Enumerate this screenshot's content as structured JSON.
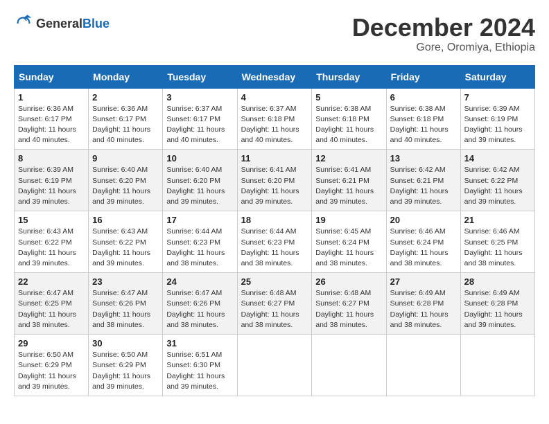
{
  "logo": {
    "general": "General",
    "blue": "Blue"
  },
  "header": {
    "month_year": "December 2024",
    "location": "Gore, Oromiya, Ethiopia"
  },
  "weekdays": [
    "Sunday",
    "Monday",
    "Tuesday",
    "Wednesday",
    "Thursday",
    "Friday",
    "Saturday"
  ],
  "weeks": [
    [
      {
        "day": 1,
        "info": "Sunrise: 6:36 AM\nSunset: 6:17 PM\nDaylight: 11 hours and 40 minutes."
      },
      {
        "day": 2,
        "info": "Sunrise: 6:36 AM\nSunset: 6:17 PM\nDaylight: 11 hours and 40 minutes."
      },
      {
        "day": 3,
        "info": "Sunrise: 6:37 AM\nSunset: 6:17 PM\nDaylight: 11 hours and 40 minutes."
      },
      {
        "day": 4,
        "info": "Sunrise: 6:37 AM\nSunset: 6:18 PM\nDaylight: 11 hours and 40 minutes."
      },
      {
        "day": 5,
        "info": "Sunrise: 6:38 AM\nSunset: 6:18 PM\nDaylight: 11 hours and 40 minutes."
      },
      {
        "day": 6,
        "info": "Sunrise: 6:38 AM\nSunset: 6:18 PM\nDaylight: 11 hours and 40 minutes."
      },
      {
        "day": 7,
        "info": "Sunrise: 6:39 AM\nSunset: 6:19 PM\nDaylight: 11 hours and 39 minutes."
      }
    ],
    [
      {
        "day": 8,
        "info": "Sunrise: 6:39 AM\nSunset: 6:19 PM\nDaylight: 11 hours and 39 minutes."
      },
      {
        "day": 9,
        "info": "Sunrise: 6:40 AM\nSunset: 6:20 PM\nDaylight: 11 hours and 39 minutes."
      },
      {
        "day": 10,
        "info": "Sunrise: 6:40 AM\nSunset: 6:20 PM\nDaylight: 11 hours and 39 minutes."
      },
      {
        "day": 11,
        "info": "Sunrise: 6:41 AM\nSunset: 6:20 PM\nDaylight: 11 hours and 39 minutes."
      },
      {
        "day": 12,
        "info": "Sunrise: 6:41 AM\nSunset: 6:21 PM\nDaylight: 11 hours and 39 minutes."
      },
      {
        "day": 13,
        "info": "Sunrise: 6:42 AM\nSunset: 6:21 PM\nDaylight: 11 hours and 39 minutes."
      },
      {
        "day": 14,
        "info": "Sunrise: 6:42 AM\nSunset: 6:22 PM\nDaylight: 11 hours and 39 minutes."
      }
    ],
    [
      {
        "day": 15,
        "info": "Sunrise: 6:43 AM\nSunset: 6:22 PM\nDaylight: 11 hours and 39 minutes."
      },
      {
        "day": 16,
        "info": "Sunrise: 6:43 AM\nSunset: 6:22 PM\nDaylight: 11 hours and 39 minutes."
      },
      {
        "day": 17,
        "info": "Sunrise: 6:44 AM\nSunset: 6:23 PM\nDaylight: 11 hours and 38 minutes."
      },
      {
        "day": 18,
        "info": "Sunrise: 6:44 AM\nSunset: 6:23 PM\nDaylight: 11 hours and 38 minutes."
      },
      {
        "day": 19,
        "info": "Sunrise: 6:45 AM\nSunset: 6:24 PM\nDaylight: 11 hours and 38 minutes."
      },
      {
        "day": 20,
        "info": "Sunrise: 6:46 AM\nSunset: 6:24 PM\nDaylight: 11 hours and 38 minutes."
      },
      {
        "day": 21,
        "info": "Sunrise: 6:46 AM\nSunset: 6:25 PM\nDaylight: 11 hours and 38 minutes."
      }
    ],
    [
      {
        "day": 22,
        "info": "Sunrise: 6:47 AM\nSunset: 6:25 PM\nDaylight: 11 hours and 38 minutes."
      },
      {
        "day": 23,
        "info": "Sunrise: 6:47 AM\nSunset: 6:26 PM\nDaylight: 11 hours and 38 minutes."
      },
      {
        "day": 24,
        "info": "Sunrise: 6:47 AM\nSunset: 6:26 PM\nDaylight: 11 hours and 38 minutes."
      },
      {
        "day": 25,
        "info": "Sunrise: 6:48 AM\nSunset: 6:27 PM\nDaylight: 11 hours and 38 minutes."
      },
      {
        "day": 26,
        "info": "Sunrise: 6:48 AM\nSunset: 6:27 PM\nDaylight: 11 hours and 38 minutes."
      },
      {
        "day": 27,
        "info": "Sunrise: 6:49 AM\nSunset: 6:28 PM\nDaylight: 11 hours and 38 minutes."
      },
      {
        "day": 28,
        "info": "Sunrise: 6:49 AM\nSunset: 6:28 PM\nDaylight: 11 hours and 39 minutes."
      }
    ],
    [
      {
        "day": 29,
        "info": "Sunrise: 6:50 AM\nSunset: 6:29 PM\nDaylight: 11 hours and 39 minutes."
      },
      {
        "day": 30,
        "info": "Sunrise: 6:50 AM\nSunset: 6:29 PM\nDaylight: 11 hours and 39 minutes."
      },
      {
        "day": 31,
        "info": "Sunrise: 6:51 AM\nSunset: 6:30 PM\nDaylight: 11 hours and 39 minutes."
      },
      null,
      null,
      null,
      null
    ]
  ]
}
